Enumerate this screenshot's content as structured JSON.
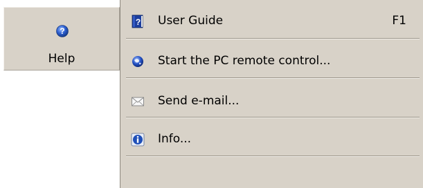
{
  "help_button": {
    "label": "Help",
    "icon": "help-question-icon"
  },
  "menu": {
    "items": [
      {
        "label": "User Guide",
        "shortcut": "F1",
        "icon": "user-guide-book-icon"
      },
      {
        "label": "Start the PC remote control...",
        "shortcut": "",
        "icon": "globe-remote-icon"
      },
      {
        "label": "Send e-mail...",
        "shortcut": "",
        "icon": "envelope-icon"
      },
      {
        "label": "Info...",
        "shortcut": "",
        "icon": "info-icon"
      }
    ]
  },
  "colors": {
    "panel_bg": "#d8d2c8",
    "separator_dark": "#9d978c",
    "separator_light": "#f3f0ea",
    "icon_blue": "#1f4fb8"
  }
}
